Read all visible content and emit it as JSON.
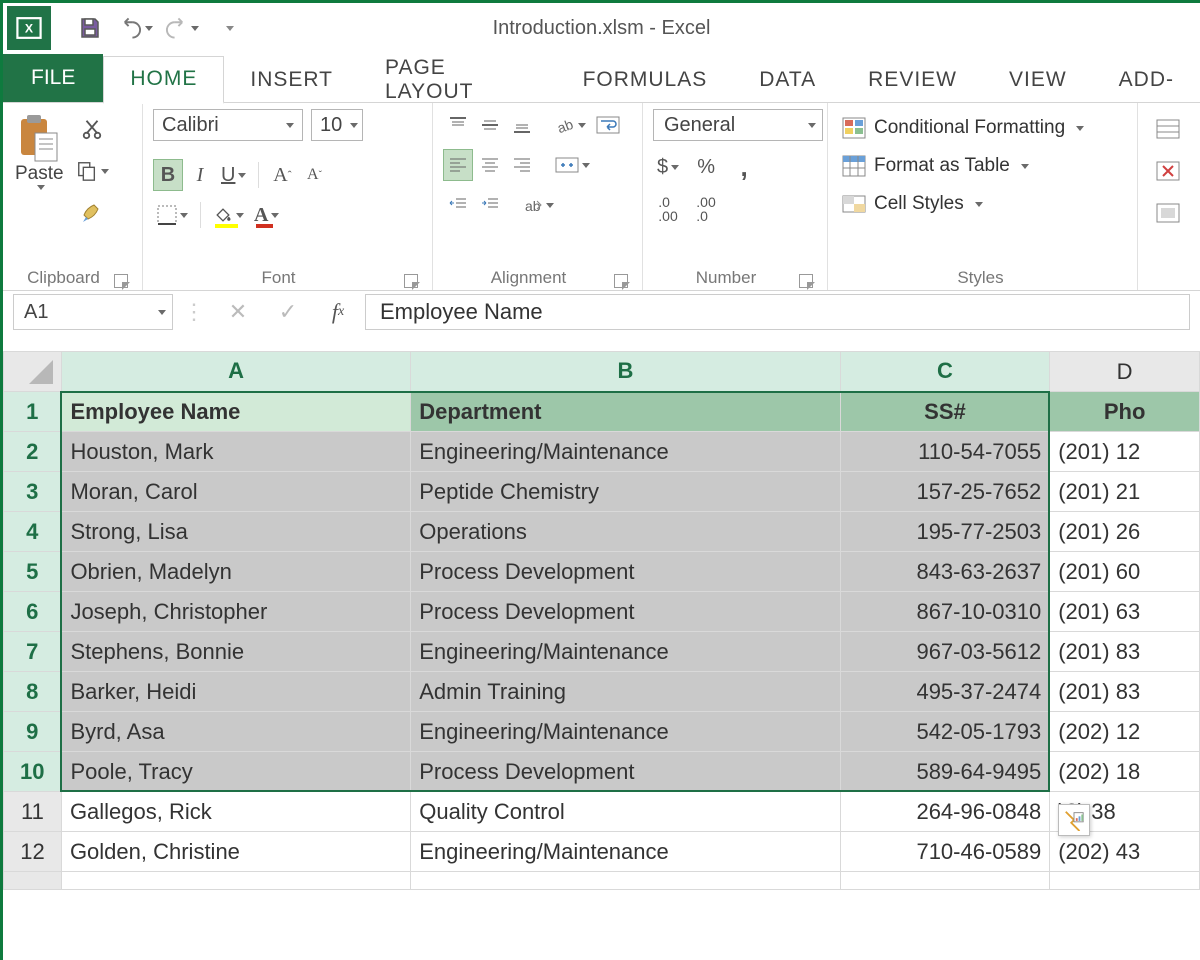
{
  "title": "Introduction.xlsm - Excel",
  "tabs": {
    "file": "FILE",
    "home": "HOME",
    "insert": "INSERT",
    "pagelayout": "PAGE LAYOUT",
    "formulas": "FORMULAS",
    "data": "DATA",
    "review": "REVIEW",
    "view": "VIEW",
    "addins": "ADD-"
  },
  "ribbon": {
    "clipboard_paste": "Paste",
    "clipboard_label": "Clipboard",
    "font_name": "Calibri",
    "font_size": "10",
    "font_label": "Font",
    "alignment_label": "Alignment",
    "number_format": "General",
    "number_label": "Number",
    "cond_fmt": "Conditional Formatting",
    "fmt_table": "Format as Table",
    "cell_styles": "Cell Styles",
    "styles_label": "Styles"
  },
  "namebox": "A1",
  "formula": "Employee Name",
  "columns": [
    "A",
    "B",
    "C",
    "D"
  ],
  "headers": {
    "A": "Employee Name",
    "B": "Department",
    "C": "SS#",
    "D": "Pho"
  },
  "rows": [
    {
      "n": 2,
      "A": "Houston, Mark",
      "B": "Engineering/Maintenance",
      "C": "110-54-7055",
      "D": "(201) 12"
    },
    {
      "n": 3,
      "A": "Moran, Carol",
      "B": "Peptide Chemistry",
      "C": "157-25-7652",
      "D": "(201) 21"
    },
    {
      "n": 4,
      "A": "Strong, Lisa",
      "B": "Operations",
      "C": "195-77-2503",
      "D": "(201) 26"
    },
    {
      "n": 5,
      "A": "Obrien, Madelyn",
      "B": "Process Development",
      "C": "843-63-2637",
      "D": "(201) 60"
    },
    {
      "n": 6,
      "A": "Joseph, Christopher",
      "B": "Process Development",
      "C": "867-10-0310",
      "D": "(201) 63"
    },
    {
      "n": 7,
      "A": "Stephens, Bonnie",
      "B": "Engineering/Maintenance",
      "C": "967-03-5612",
      "D": "(201) 83"
    },
    {
      "n": 8,
      "A": "Barker, Heidi",
      "B": "Admin Training",
      "C": "495-37-2474",
      "D": "(201) 83"
    },
    {
      "n": 9,
      "A": "Byrd, Asa",
      "B": "Engineering/Maintenance",
      "C": "542-05-1793",
      "D": "(202) 12"
    },
    {
      "n": 10,
      "A": "Poole, Tracy",
      "B": "Process Development",
      "C": "589-64-9495",
      "D": "(202) 18"
    },
    {
      "n": 11,
      "A": "Gallegos, Rick",
      "B": "Quality Control",
      "C": "264-96-0848",
      "D": "      )2) 38"
    },
    {
      "n": 12,
      "A": "Golden, Christine",
      "B": "Engineering/Maintenance",
      "C": "710-46-0589",
      "D": "(202) 43"
    }
  ],
  "selection": {
    "rows_from": 1,
    "rows_to": 10,
    "cols": [
      "A",
      "B",
      "C"
    ]
  }
}
